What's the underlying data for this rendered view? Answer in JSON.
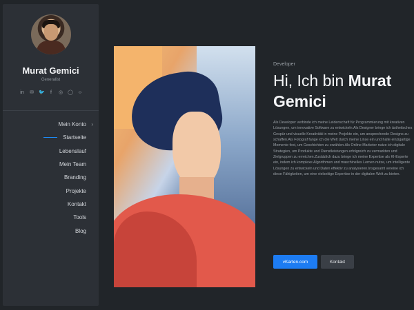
{
  "profile": {
    "name": "Murat Gemici",
    "subtitle": "Generalist"
  },
  "social_icons": [
    "linkedin-icon",
    "mail-icon",
    "twitter-icon",
    "facebook-icon",
    "instagram-icon",
    "whatsapp-icon",
    "code-icon"
  ],
  "nav": {
    "items": [
      {
        "label": "Mein Konto",
        "has_chevron": true
      },
      {
        "label": "Startseite",
        "active": true
      },
      {
        "label": "Lebenslauf"
      },
      {
        "label": "Mein Team"
      },
      {
        "label": "Branding"
      },
      {
        "label": "Projekte"
      },
      {
        "label": "Kontakt"
      },
      {
        "label": "Tools"
      },
      {
        "label": "Blog"
      }
    ]
  },
  "hero": {
    "eyebrow": "Developer",
    "headline_prefix": "Hi, Ich bin ",
    "headline_name": "Murat Gemici",
    "bio": "Als Developer verbinde ich meine Leidenschaft für Programmierung mit kreativen Lösungen, um innovative Software zu entwickeln.Als Designer bringe ich ästhetisches Gespür und visuelle Kreativität in meine Projekte ein, um ansprechende Designs zu schaffen.Als Fotograf fange ich die Welt durch meine Linse ein und halte einzigartige Momente fest, um Geschichten zu erzählen.Als Online Marketer nutze ich digitale Strategien, um Produkte und Dienstleistungen erfolgreich zu vermarkten und Zielgruppen zu erreichen.Zusätzlich dazu bringe ich meine Expertise als KI-Experte ein, indem ich komplexe Algorithmen und maschinelles Lernen nutze, um intelligente Lösungen zu entwickeln und Daten effektiv zu analysieren.Insgesamt vereine ich diese Fähigkeiten, um eine vielseitige Expertise in der digitalen Welt zu bieten.",
    "primary_button": "vKarten.com",
    "secondary_button": "Kontakt"
  },
  "colors": {
    "accent": "#1d7cf2",
    "sidebar_bg": "#2c3036",
    "page_bg": "#212529"
  }
}
